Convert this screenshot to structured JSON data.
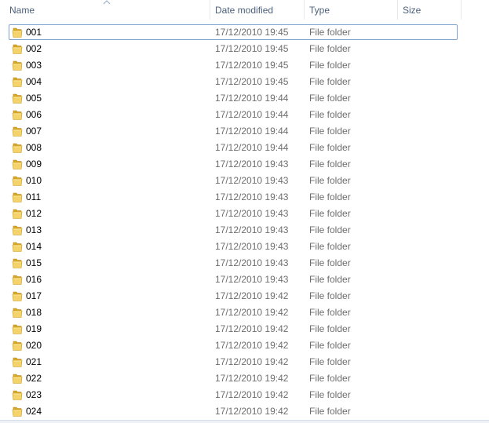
{
  "columns": {
    "name": "Name",
    "date_modified": "Date modified",
    "type": "Type",
    "size": "Size"
  },
  "sort": {
    "column": "name",
    "direction": "ascending",
    "icon": "sort-up-arrow-icon"
  },
  "icons": {
    "folder": "folder-icon"
  },
  "colors": {
    "header_text": "#4c607a",
    "secondary_text": "#6d6d6d",
    "focus_border": "#7da2ce",
    "folder_yellow": "#e8c14a"
  },
  "focused_row": 0,
  "files": [
    {
      "name": "001",
      "date": "17/12/2010 19:45",
      "type": "File folder",
      "size": ""
    },
    {
      "name": "002",
      "date": "17/12/2010 19:45",
      "type": "File folder",
      "size": ""
    },
    {
      "name": "003",
      "date": "17/12/2010 19:45",
      "type": "File folder",
      "size": ""
    },
    {
      "name": "004",
      "date": "17/12/2010 19:45",
      "type": "File folder",
      "size": ""
    },
    {
      "name": "005",
      "date": "17/12/2010 19:44",
      "type": "File folder",
      "size": ""
    },
    {
      "name": "006",
      "date": "17/12/2010 19:44",
      "type": "File folder",
      "size": ""
    },
    {
      "name": "007",
      "date": "17/12/2010 19:44",
      "type": "File folder",
      "size": ""
    },
    {
      "name": "008",
      "date": "17/12/2010 19:44",
      "type": "File folder",
      "size": ""
    },
    {
      "name": "009",
      "date": "17/12/2010 19:43",
      "type": "File folder",
      "size": ""
    },
    {
      "name": "010",
      "date": "17/12/2010 19:43",
      "type": "File folder",
      "size": ""
    },
    {
      "name": "011",
      "date": "17/12/2010 19:43",
      "type": "File folder",
      "size": ""
    },
    {
      "name": "012",
      "date": "17/12/2010 19:43",
      "type": "File folder",
      "size": ""
    },
    {
      "name": "013",
      "date": "17/12/2010 19:43",
      "type": "File folder",
      "size": ""
    },
    {
      "name": "014",
      "date": "17/12/2010 19:43",
      "type": "File folder",
      "size": ""
    },
    {
      "name": "015",
      "date": "17/12/2010 19:43",
      "type": "File folder",
      "size": ""
    },
    {
      "name": "016",
      "date": "17/12/2010 19:43",
      "type": "File folder",
      "size": ""
    },
    {
      "name": "017",
      "date": "17/12/2010 19:42",
      "type": "File folder",
      "size": ""
    },
    {
      "name": "018",
      "date": "17/12/2010 19:42",
      "type": "File folder",
      "size": ""
    },
    {
      "name": "019",
      "date": "17/12/2010 19:42",
      "type": "File folder",
      "size": ""
    },
    {
      "name": "020",
      "date": "17/12/2010 19:42",
      "type": "File folder",
      "size": ""
    },
    {
      "name": "021",
      "date": "17/12/2010 19:42",
      "type": "File folder",
      "size": ""
    },
    {
      "name": "022",
      "date": "17/12/2010 19:42",
      "type": "File folder",
      "size": ""
    },
    {
      "name": "023",
      "date": "17/12/2010 19:42",
      "type": "File folder",
      "size": ""
    },
    {
      "name": "024",
      "date": "17/12/2010 19:42",
      "type": "File folder",
      "size": ""
    }
  ]
}
